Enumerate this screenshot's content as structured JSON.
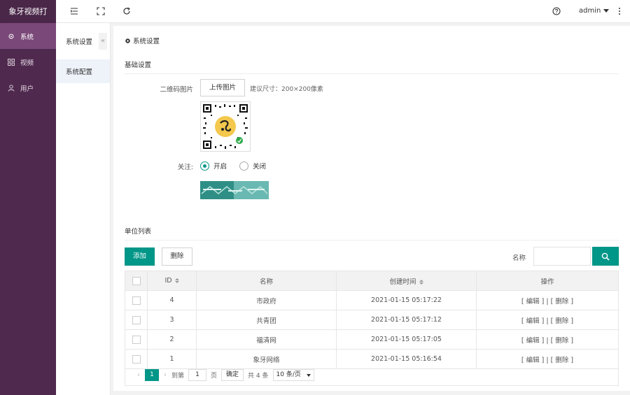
{
  "app": {
    "logo": "象牙视频打"
  },
  "sidebar": {
    "items": [
      {
        "label": "系统",
        "icon": "gear-icon",
        "active": true
      },
      {
        "label": "视频",
        "icon": "grid-icon",
        "active": false
      },
      {
        "label": "用户",
        "icon": "user-icon",
        "active": false
      }
    ]
  },
  "header": {
    "user": "admin",
    "icons": [
      "menu-fold-icon",
      "fullscreen-icon",
      "refresh-icon",
      "help-icon",
      "more-icon"
    ]
  },
  "subnav": {
    "title": "系统设置",
    "collapse": "«",
    "items": [
      {
        "label": "系统配置"
      }
    ]
  },
  "page": {
    "title": "系统设置",
    "basic_section": "基础设置",
    "qr_label": "二维码图片",
    "upload_button": "上传图片",
    "upload_hint": "建议尺寸：200×200像素",
    "follow_label": "关注:",
    "radio_on": "开启",
    "radio_off": "关闭",
    "list_section": "单位列表",
    "add_button": "添加",
    "delete_button": "删除",
    "search_label": "名称",
    "search_value": ""
  },
  "table": {
    "headers": {
      "id": "ID",
      "name": "名称",
      "created": "创建时间",
      "actions": "操作"
    },
    "rows": [
      {
        "id": "4",
        "name": "市政府",
        "created": "2021-01-15 05:17:22",
        "edit": "[ 编辑 ]",
        "del": "[ 删除 ]"
      },
      {
        "id": "3",
        "name": "共青团",
        "created": "2021-01-15 05:17:12",
        "edit": "[ 编辑 ]",
        "del": "[ 删除 ]"
      },
      {
        "id": "2",
        "name": "福清网",
        "created": "2021-01-15 05:17:05",
        "edit": "[ 编辑 ]",
        "del": "[ 删除 ]"
      },
      {
        "id": "1",
        "name": "象牙网络",
        "created": "2021-01-15 05:16:54",
        "edit": "[ 编辑 ]",
        "del": "[ 删除 ]"
      }
    ]
  },
  "pager": {
    "current": "1",
    "goto_label": "到第",
    "goto_value": "1",
    "page_unit": "页",
    "confirm": "确定",
    "total": "共 4 条",
    "per_page": "10 条/页"
  },
  "colors": {
    "accent": "#009688",
    "sidebar": "#4f2a4e",
    "sidebar_active": "#7a4879"
  }
}
